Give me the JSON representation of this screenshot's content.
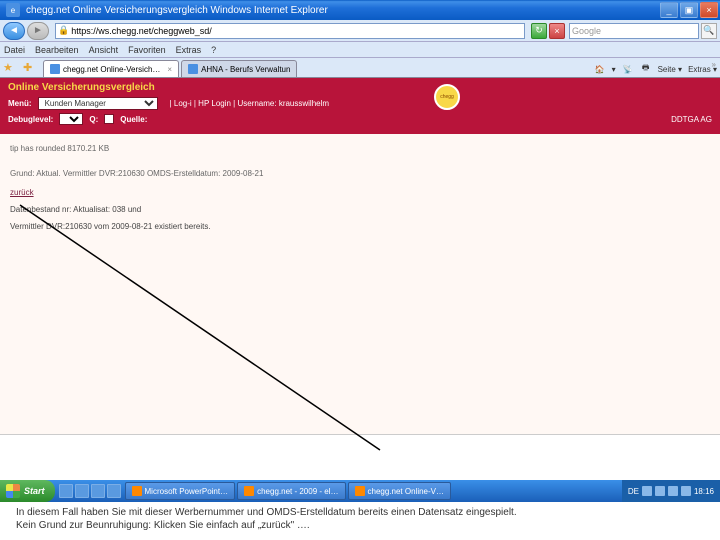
{
  "titlebar": {
    "title": "chegg.net Online Versicherungsvergleich   Windows Internet Explorer"
  },
  "nav": {
    "url": "https://ws.chegg.net/cheggweb_sd/",
    "search_placeholder": "Google"
  },
  "menubar": [
    "Datei",
    "Bearbeiten",
    "Ansicht",
    "Favoriten",
    "Extras",
    "?"
  ],
  "tabs": [
    {
      "label": "chegg.net Online-Versich… ",
      "active": true
    },
    {
      "label": "AHNA - Berufs Verwaltun",
      "active": false
    }
  ],
  "toolbar": {
    "home": "▾",
    "seite": "Seite ▾",
    "extras": "Extras ▾"
  },
  "banner": {
    "title": "Online Versicherungsvergleich",
    "menu_label": "Menü:",
    "menu_value": "Kunden Manager",
    "links": "| Log-i | HP Login | Username: krausswilhelm",
    "debug_label": "Debuglevel:",
    "q_label": "Q:",
    "quelle_label": "Quelle:",
    "company": "DDTGA AG",
    "badge": "chegg"
  },
  "content": {
    "line1": "tip has rounded 8170.21 KB",
    "line2": "Grund: Aktual. Vermittler DVR:210630 OMDS-Erstelldatum: 2009-08-21",
    "back_link": "zurück",
    "warn1": "Datenbestand nr: Aktualisat: 038 und",
    "warn2": "Vermittler DVR:210630 vom 2009-08-21 existiert bereits."
  },
  "taskbar": {
    "start": "Start",
    "tasks": [
      "Microsoft PowerPoint…",
      "chegg.net - 2009 - el…",
      "chegg.net Online-V…"
    ],
    "lang": "DE",
    "time": "18:16"
  },
  "caption": {
    "line1": "In diesem Fall haben Sie mit dieser Werbernummer und OMDS-Erstelldatum bereits einen Datensatz eingespielt.",
    "line2": "Kein Grund zur Beunruhigung: Klicken Sie einfach auf „zurück\" …."
  }
}
